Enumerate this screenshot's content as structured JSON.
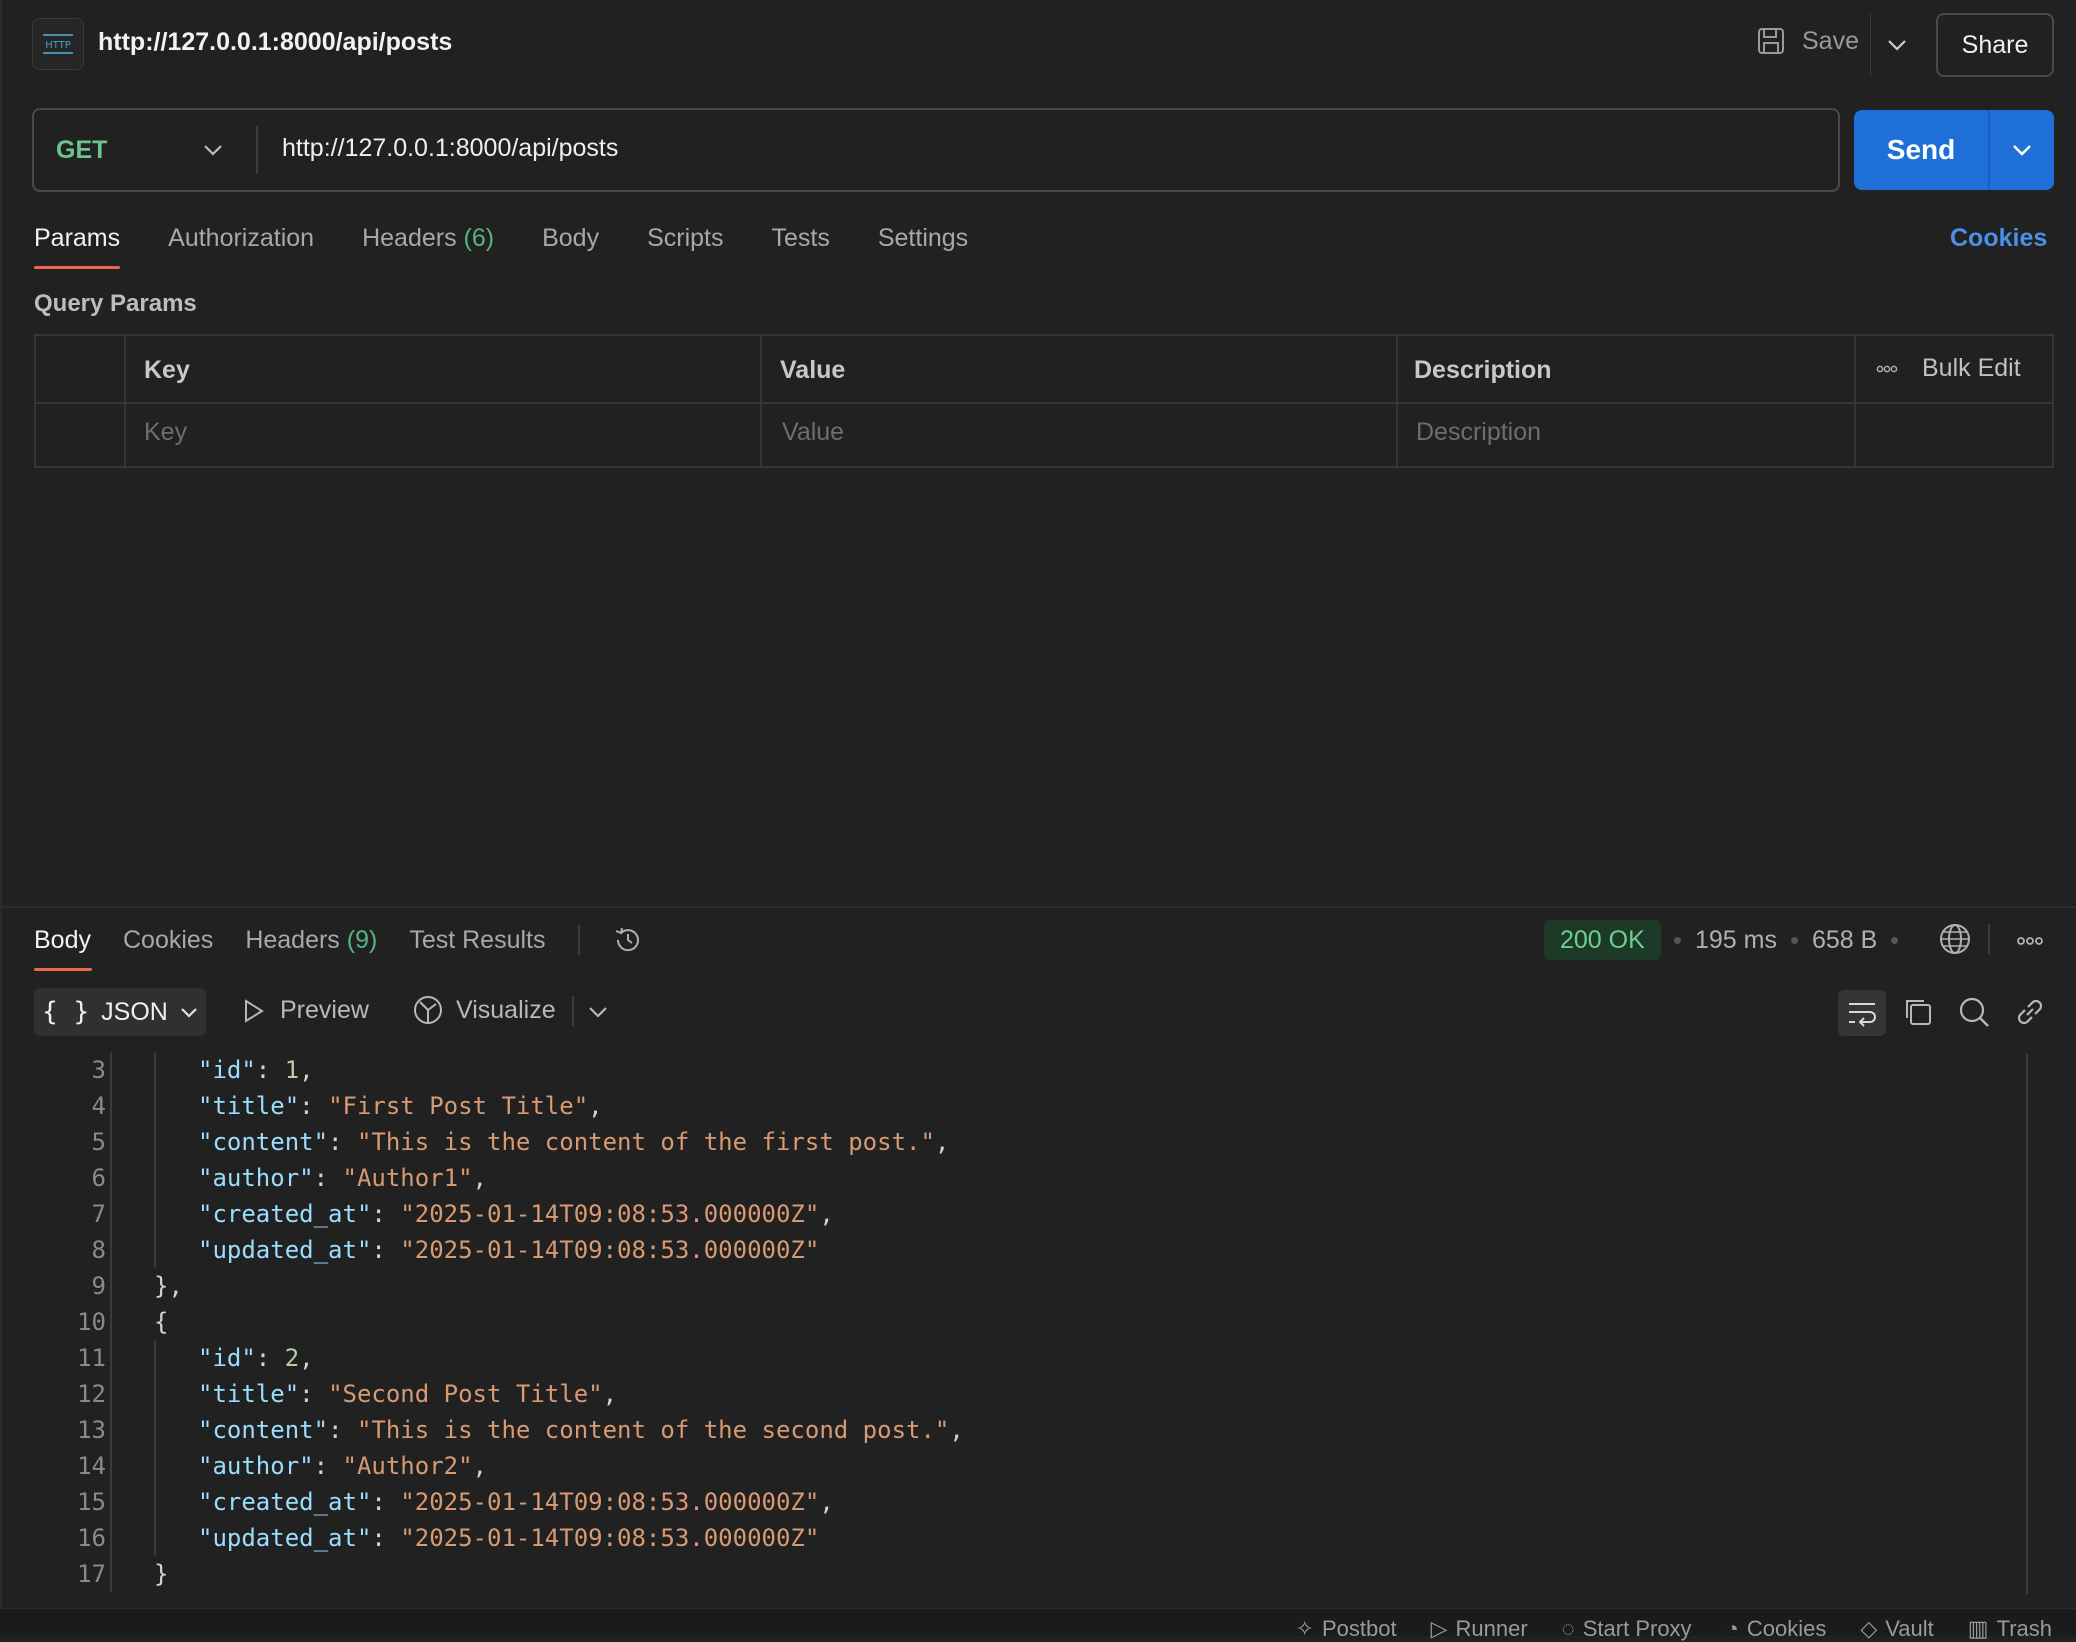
{
  "header": {
    "badge_text": "HTTP",
    "title": "http://127.0.0.1:8000/api/posts",
    "save_label": "Save",
    "share_label": "Share"
  },
  "request": {
    "method": "GET",
    "url": "http://127.0.0.1:8000/api/posts",
    "send_label": "Send",
    "tabs": [
      {
        "label": "Params"
      },
      {
        "label": "Authorization"
      },
      {
        "label": "Headers",
        "count": "(6)"
      },
      {
        "label": "Body"
      },
      {
        "label": "Scripts"
      },
      {
        "label": "Tests"
      },
      {
        "label": "Settings"
      }
    ],
    "cookies_label": "Cookies",
    "active_tab": "Params"
  },
  "query_params": {
    "title": "Query Params",
    "columns": {
      "key": "Key",
      "value": "Value",
      "description": "Description"
    },
    "bulk_edit": "Bulk Edit",
    "placeholders": {
      "key": "Key",
      "value": "Value",
      "description": "Description"
    }
  },
  "response": {
    "tabs": [
      {
        "label": "Body"
      },
      {
        "label": "Cookies"
      },
      {
        "label": "Headers",
        "count": "(9)"
      },
      {
        "label": "Test Results"
      }
    ],
    "active_tab": "Body",
    "status": "200 OK",
    "time": "195 ms",
    "size": "658 B",
    "format": "JSON",
    "preview_label": "Preview",
    "visualize_label": "Visualize",
    "lines": [
      {
        "n": "3",
        "depth": 2,
        "parts": [
          [
            "k",
            "\"id\""
          ],
          [
            "p",
            ": "
          ],
          [
            "n",
            "1"
          ],
          [
            "p",
            ","
          ]
        ]
      },
      {
        "n": "4",
        "depth": 2,
        "parts": [
          [
            "k",
            "\"title\""
          ],
          [
            "p",
            ": "
          ],
          [
            "s",
            "\"First Post Title\""
          ],
          [
            "p",
            ","
          ]
        ]
      },
      {
        "n": "5",
        "depth": 2,
        "parts": [
          [
            "k",
            "\"content\""
          ],
          [
            "p",
            ": "
          ],
          [
            "s",
            "\"This is the content of the first post.\""
          ],
          [
            "p",
            ","
          ]
        ]
      },
      {
        "n": "6",
        "depth": 2,
        "parts": [
          [
            "k",
            "\"author\""
          ],
          [
            "p",
            ": "
          ],
          [
            "s",
            "\"Author1\""
          ],
          [
            "p",
            ","
          ]
        ]
      },
      {
        "n": "7",
        "depth": 2,
        "parts": [
          [
            "k",
            "\"created_at\""
          ],
          [
            "p",
            ": "
          ],
          [
            "s",
            "\"2025-01-14T09:08:53.000000Z\""
          ],
          [
            "p",
            ","
          ]
        ]
      },
      {
        "n": "8",
        "depth": 2,
        "parts": [
          [
            "k",
            "\"updated_at\""
          ],
          [
            "p",
            ": "
          ],
          [
            "s",
            "\"2025-01-14T09:08:53.000000Z\""
          ]
        ]
      },
      {
        "n": "9",
        "depth": 1,
        "parts": [
          [
            "p",
            "},"
          ]
        ]
      },
      {
        "n": "10",
        "depth": 1,
        "parts": [
          [
            "p",
            "{"
          ]
        ]
      },
      {
        "n": "11",
        "depth": 2,
        "parts": [
          [
            "k",
            "\"id\""
          ],
          [
            "p",
            ": "
          ],
          [
            "n",
            "2"
          ],
          [
            "p",
            ","
          ]
        ]
      },
      {
        "n": "12",
        "depth": 2,
        "parts": [
          [
            "k",
            "\"title\""
          ],
          [
            "p",
            ": "
          ],
          [
            "s",
            "\"Second Post Title\""
          ],
          [
            "p",
            ","
          ]
        ]
      },
      {
        "n": "13",
        "depth": 2,
        "parts": [
          [
            "k",
            "\"content\""
          ],
          [
            "p",
            ": "
          ],
          [
            "s",
            "\"This is the content of the second post.\""
          ],
          [
            "p",
            ","
          ]
        ]
      },
      {
        "n": "14",
        "depth": 2,
        "parts": [
          [
            "k",
            "\"author\""
          ],
          [
            "p",
            ": "
          ],
          [
            "s",
            "\"Author2\""
          ],
          [
            "p",
            ","
          ]
        ]
      },
      {
        "n": "15",
        "depth": 2,
        "parts": [
          [
            "k",
            "\"created_at\""
          ],
          [
            "p",
            ": "
          ],
          [
            "s",
            "\"2025-01-14T09:08:53.000000Z\""
          ],
          [
            "p",
            ","
          ]
        ]
      },
      {
        "n": "16",
        "depth": 2,
        "parts": [
          [
            "k",
            "\"updated_at\""
          ],
          [
            "p",
            ": "
          ],
          [
            "s",
            "\"2025-01-14T09:08:53.000000Z\""
          ]
        ]
      },
      {
        "n": "17",
        "depth": 1,
        "parts": [
          [
            "p",
            "}"
          ]
        ]
      }
    ]
  },
  "footer": {
    "items": [
      {
        "label": "Postbot",
        "icon": "postbot-icon"
      },
      {
        "label": "Runner",
        "icon": "runner-icon"
      },
      {
        "label": "Start Proxy",
        "icon": "proxy-icon"
      },
      {
        "label": "Cookies",
        "icon": "cookie-icon"
      },
      {
        "label": "Vault",
        "icon": "vault-icon"
      },
      {
        "label": "Trash",
        "icon": "trash-icon"
      }
    ]
  },
  "colors": {
    "accent_tab": "#e8694a",
    "send_button": "#1f6fd8",
    "method_get": "#6cc58f",
    "status_ok": "#6ccf8f",
    "json_key": "#9cdcfe",
    "json_string": "#d89a73",
    "json_number": "#b5cea8"
  }
}
